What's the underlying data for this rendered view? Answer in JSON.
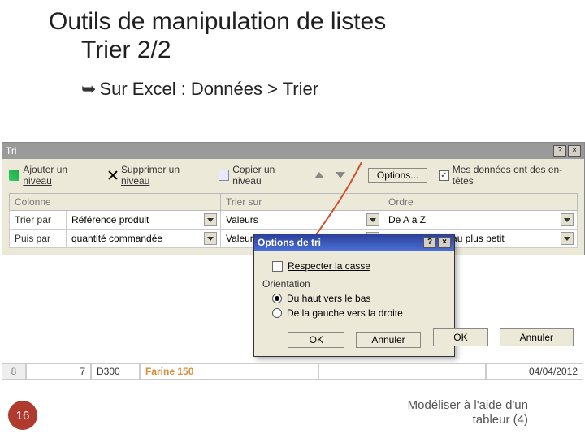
{
  "slide": {
    "title_line1": "Outils de manipulation de listes",
    "title_line2": "Trier 2/2",
    "bullet": "Sur Excel : Données > Trier",
    "number": "16",
    "footer_line1": "Modéliser à l'aide d'un",
    "footer_line2": "tableur (4)"
  },
  "sortDialog": {
    "title": "Tri",
    "help_btn": "?",
    "close_btn": "×",
    "toolbar": {
      "add": "Ajouter un niveau",
      "delete": "Supprimer un niveau",
      "copy": "Copier un niveau",
      "options": "Options...",
      "headers_label": "Mes données ont des en-têtes",
      "headers_checked": "✓"
    },
    "headers": {
      "col": "Colonne",
      "sorton": "Trier sur",
      "order": "Ordre"
    },
    "rows": [
      {
        "label": "Trier par",
        "field": "Référence produit",
        "sorton": "Valeurs",
        "order": "De A à Z"
      },
      {
        "label": "Puis par",
        "field": "quantité commandée",
        "sorton": "Valeurs",
        "order": "Du plus grand au plus petit"
      }
    ],
    "ok": "OK",
    "cancel": "Annuler"
  },
  "optionsDialog": {
    "title": "Options de tri",
    "help_btn": "?",
    "close_btn": "×",
    "respect_case": "Respecter la casse",
    "orientation_label": "Orientation",
    "radio1": "Du haut vers le bas",
    "radio2": "De la gauche vers la droite",
    "ok": "OK",
    "cancel": "Annuler"
  },
  "sheet": {
    "rownum": "8",
    "c1": "7",
    "c2": "D300",
    "c3": "Farine 150",
    "c4": "04/04/2012"
  }
}
